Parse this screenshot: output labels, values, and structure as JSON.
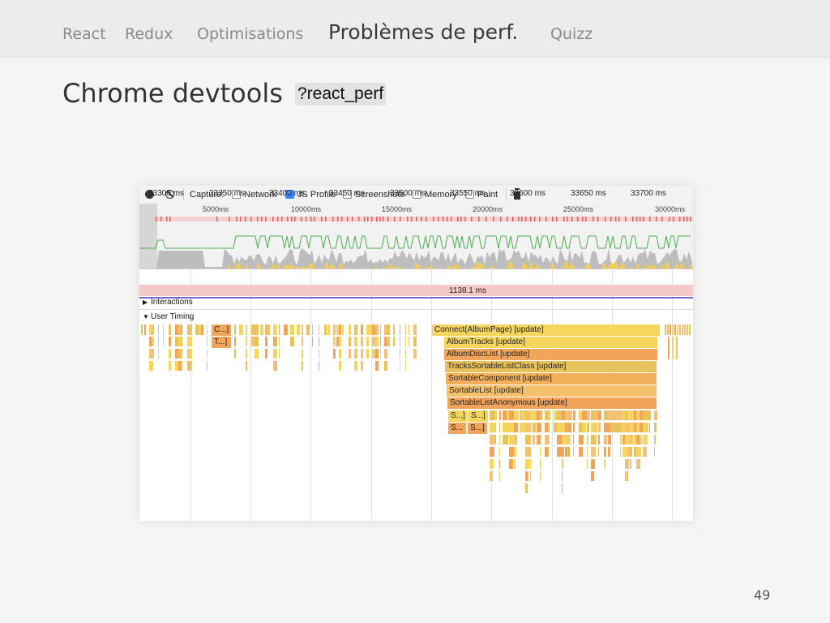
{
  "nav": {
    "items": [
      {
        "label": "React"
      },
      {
        "label": "Redux"
      },
      {
        "label": "Optimisations"
      },
      {
        "label": "Problèmes de perf."
      },
      {
        "label": "Quizz"
      }
    ],
    "active_index": 3
  },
  "slide": {
    "title": "Chrome devtools",
    "code_tag": "?react_perf",
    "page_number": "49"
  },
  "devtools": {
    "capture_label": "Capture:",
    "options": [
      {
        "label": "Network",
        "checked": false
      },
      {
        "label": "JS Profile",
        "checked": true
      },
      {
        "label": "Screenshots",
        "checked": false
      },
      {
        "label": "Memory",
        "checked": false
      },
      {
        "label": "Paint",
        "checked": false
      }
    ],
    "overview_ruler": [
      "5000ms",
      "10000ms",
      "15000ms",
      "20000ms",
      "25000ms",
      "30000ms"
    ],
    "timeline_ticks": [
      "33300 ms",
      "33350 ms",
      "33400 ms",
      "33450 ms",
      "33500 ms",
      "33550 ms",
      "33600 ms",
      "33650 ms",
      "33700 ms"
    ],
    "selection_duration": "1138.1 ms",
    "interactions_label": "Interactions",
    "user_timing_label": "User Timing",
    "flame_labels": {
      "small_c": "C...]",
      "small_t": "T...]",
      "connect": "Connect(AlbumPage) [update]",
      "album_tracks": "AlbumTracks [update]",
      "album_disc_list": "AlbumDiscList [update]",
      "tracks_sortable": "TracksSortableListClass [update]",
      "sortable_component": "SortableComponent [update]",
      "sortable_list": "SortableList [update]",
      "sortable_list_anon": "SortableListAnonymous [update]",
      "s1": "S...]",
      "s2": "S...]",
      "s3": "S...",
      "s4": "S...]"
    },
    "colors": {
      "yellow": "#f6d55c",
      "orange": "#f2a55a",
      "light_orange": "#f5c177",
      "mustard": "#e8c25a"
    }
  }
}
